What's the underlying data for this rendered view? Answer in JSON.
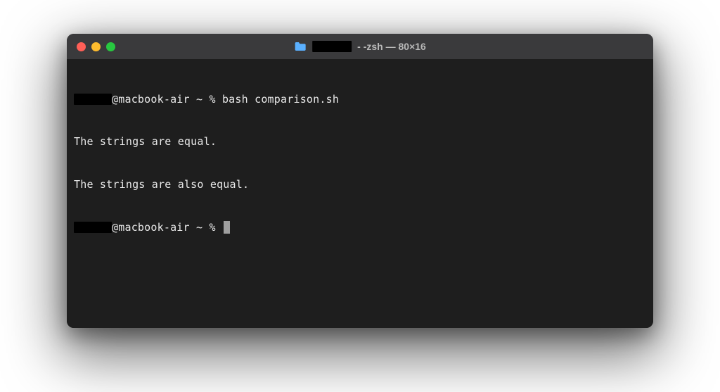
{
  "window": {
    "title_prefix": "",
    "title_suffix": " - -zsh — 80×16"
  },
  "terminal": {
    "lines": [
      {
        "redacted_prefix": true,
        "prompt": "@macbook-air ~ % ",
        "command": "bash comparison.sh"
      },
      {
        "redacted_prefix": false,
        "text": "The strings are equal."
      },
      {
        "redacted_prefix": false,
        "text": "The strings are also equal."
      },
      {
        "redacted_prefix": true,
        "prompt": "@macbook-air ~ % ",
        "cursor": true
      }
    ]
  },
  "colors": {
    "window_bg": "#1e1e1e",
    "titlebar_bg": "#3a3a3c",
    "text": "#e8e8e8",
    "close": "#ff5f57",
    "minimize": "#febc2e",
    "maximize": "#28c840",
    "folder_icon": "#5ab0ff"
  }
}
